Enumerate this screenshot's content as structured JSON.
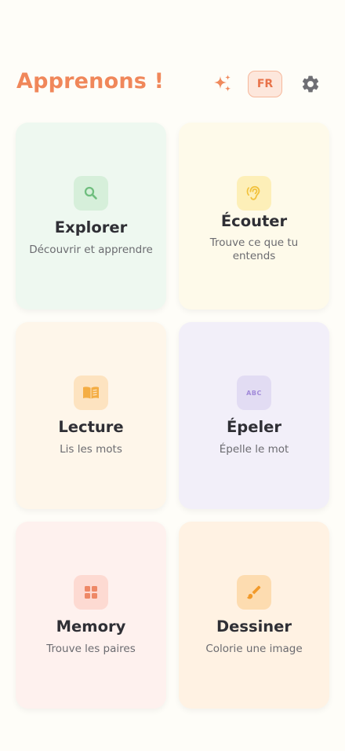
{
  "header": {
    "title": "Apprenons !",
    "language": "FR",
    "icons": [
      "sparkles-icon",
      "gear-icon"
    ]
  },
  "activities": [
    {
      "label": "Explorer",
      "subtitle": "Découvrir et apprendre",
      "icon": "search-icon",
      "accent": "#7cc489",
      "icon_bg": "#d6efda"
    },
    {
      "label": "Écouter",
      "subtitle": "Trouve ce que tu entends",
      "icon": "ear-icon",
      "accent": "#f2c23c",
      "icon_bg": "#fdefb8"
    },
    {
      "label": "Lecture",
      "subtitle": "Lis les mots",
      "icon": "book-icon",
      "accent": "#f4ad43",
      "icon_bg": "#fde3c0"
    },
    {
      "label": "Épeler",
      "subtitle": "Épelle le mot",
      "icon": "abc-icon",
      "icon_text": "ABC",
      "accent": "#a18ad9",
      "icon_bg": "#e2dcf3"
    },
    {
      "label": "Memory",
      "subtitle": "Trouve les paires",
      "icon": "grid-icon",
      "accent": "#ee8866",
      "icon_bg": "#fddad2"
    },
    {
      "label": "Dessiner",
      "subtitle": "Colorie une image",
      "icon": "paintbrush-icon",
      "accent": "#f29a2a",
      "icon_bg": "#fddcb0"
    }
  ]
}
